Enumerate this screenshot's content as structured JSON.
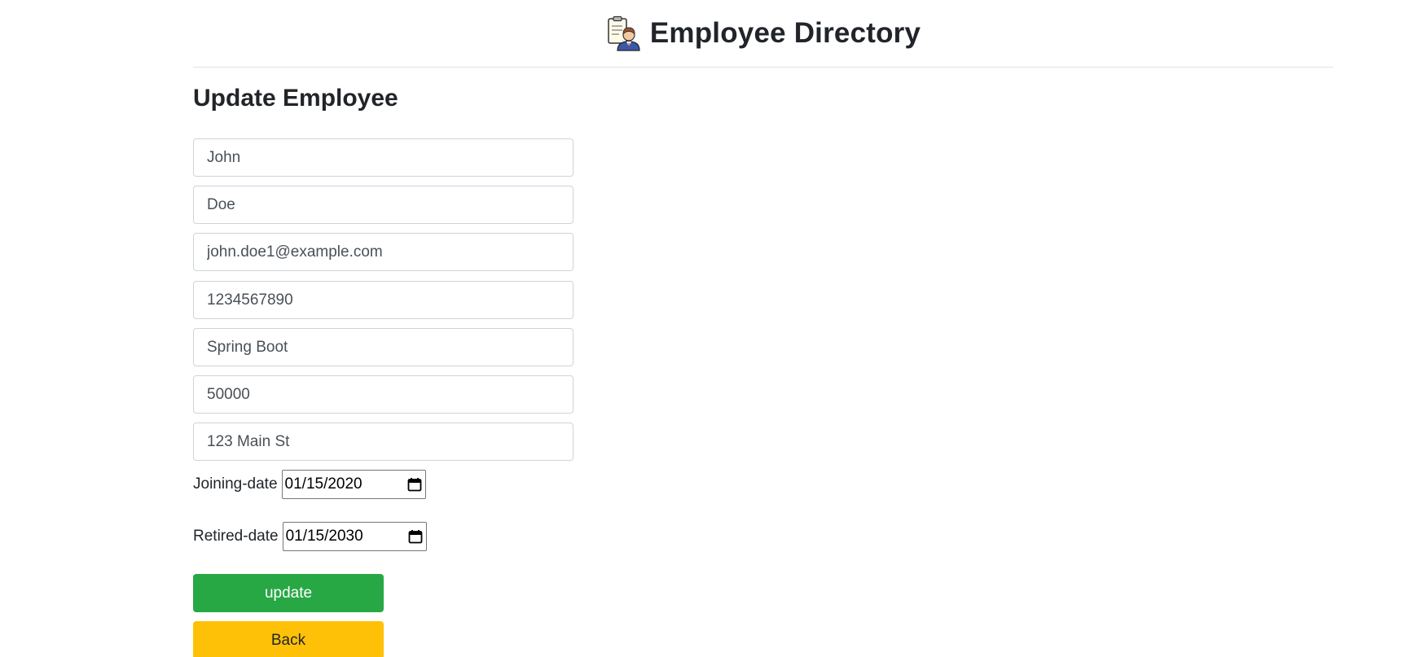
{
  "header": {
    "title": "Employee Directory",
    "logo_icon": "employee-directory-logo-icon"
  },
  "form": {
    "title": "Update Employee",
    "fields": {
      "first_name": "John",
      "last_name": "Doe",
      "email": "john.doe1@example.com",
      "phone": "1234567890",
      "department": "Spring Boot",
      "salary": "50000",
      "address": "123 Main St"
    },
    "joining_date_label": "Joining-date",
    "joining_date": "01/15/2020",
    "retired_date_label": "Retired-date",
    "retired_date": "01/15/2030",
    "update_label": "update",
    "back_label": "Back"
  },
  "colors": {
    "update_button": "#28a745",
    "back_button": "#ffc107"
  }
}
